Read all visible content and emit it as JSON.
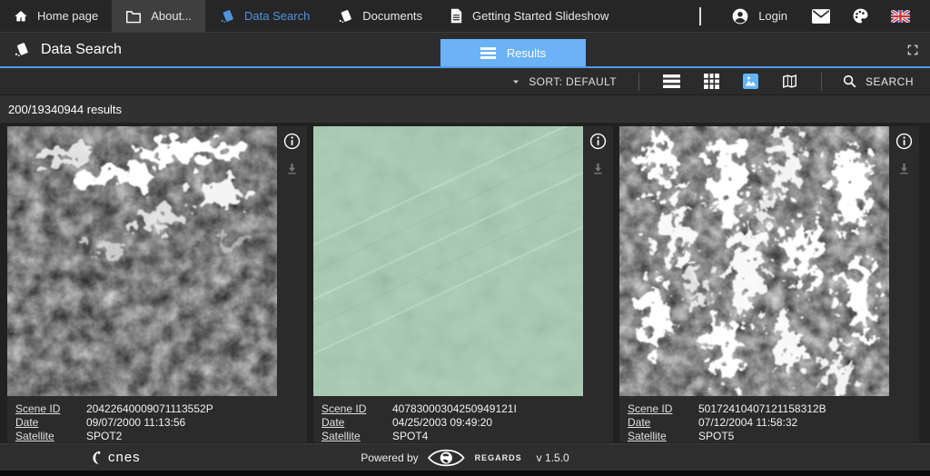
{
  "colors": {
    "accent_blue": "#6cb2f6",
    "active_link_blue": "#4f93dd",
    "header_underline_blue": "#4f9ae8",
    "selected_view_blue": "#64b5f6",
    "sea_thumbnail_green": "#a6cbb1"
  },
  "top_nav": {
    "items": [
      {
        "icon": "home-icon",
        "label": "Home page"
      },
      {
        "icon": "folder-icon",
        "label": "About..."
      },
      {
        "icon": "catalog-icon",
        "label": "Data Search"
      },
      {
        "icon": "catalog-icon",
        "label": "Documents"
      },
      {
        "icon": "document-icon",
        "label": "Getting Started Slideshow"
      }
    ],
    "login_label": "Login",
    "right_icons": [
      "account-icon",
      "mail-icon",
      "palette-icon",
      "uk-flag-icon"
    ]
  },
  "module_bar": {
    "title": "Data Search",
    "title_icon": "catalog-icon",
    "tab_label": "Results",
    "tab_icon": "list-icon",
    "fullscreen_icon": "fullscreen-icon"
  },
  "toolbar": {
    "sort_label": "SORT: DEFAULT",
    "view_icons": [
      "list-icon",
      "table-icon",
      "image-icon",
      "map-icon"
    ],
    "selected_view": "image-icon",
    "search_label": "SEARCH"
  },
  "results": {
    "count_text": "200/19340944 results",
    "labels": {
      "scene_id": "Scene ID",
      "date": "Date",
      "satellite": "Satellite"
    },
    "cards": [
      {
        "scene_id": "20422640009071113552P",
        "date": "09/07/2000 11:13:56",
        "satellite": "SPOT2",
        "thumbnail": "grayscale terrain with clouds"
      },
      {
        "scene_id": "40783000304250949121I",
        "date": "04/25/2003 09:49:20",
        "satellite": "SPOT4",
        "thumbnail": "pale green sea surface"
      },
      {
        "scene_id": "50172410407121158312B",
        "date": "07/12/2004 11:58:32",
        "satellite": "SPOT5",
        "thumbnail": "white cloud field over dark terrain"
      }
    ]
  },
  "footer": {
    "cnes_label": "cnes",
    "powered_by": "Powered by",
    "regards_label": "REGARDS",
    "version": "v 1.5.0"
  }
}
